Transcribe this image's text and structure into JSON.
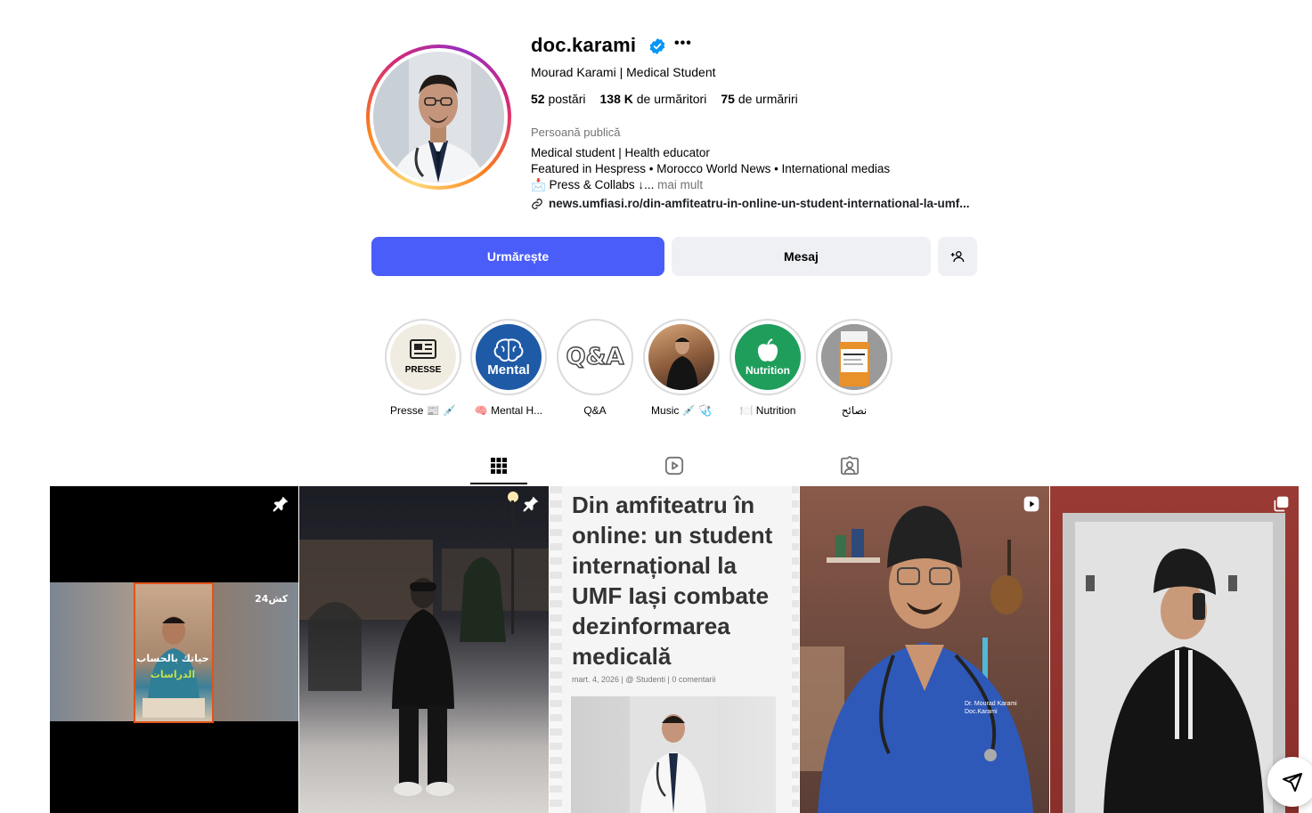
{
  "profile": {
    "username": "doc.karami",
    "more_icon": "•••",
    "full_name": "Mourad Karami | Medical Student",
    "stats": {
      "posts_count": "52",
      "posts_label": "postări",
      "followers_count": "138 K",
      "followers_label": "de urmăritori",
      "following_count": "75",
      "following_label": "de urmăriri"
    },
    "category": "Persoană publică",
    "bio_line1": "Medical student | Health educator",
    "bio_line2": "Featured in Hespress • Morocco World News • International medias",
    "bio_line3": "📩 Press & Collabs ↓...",
    "more_link": "mai mult",
    "link_text": "news.umfiasi.ro/din-amfiteatru-in-online-un-student-international-la-umf..."
  },
  "actions": {
    "follow_label": "Urmărește",
    "message_label": "Mesaj"
  },
  "highlights": [
    {
      "label": "Presse 📰 💉",
      "cover_text": "PRESSE"
    },
    {
      "label": "🧠 Mental H...",
      "cover_text": "Mental"
    },
    {
      "label": "Q&A",
      "cover_text": "Q&A"
    },
    {
      "label": "Music 💉 🩺",
      "cover_text": ""
    },
    {
      "label": "🍽️ Nutrition",
      "cover_text": "Nutrition"
    },
    {
      "label": "نصائح",
      "cover_text": ""
    }
  ],
  "posts": {
    "p1_overlay_top": "حياتك بالحساب",
    "p1_overlay_bottom": "الدراسات",
    "p1_logo": "كش24",
    "p3_title": "Din amfiteatru în online: un student internațional la UMF Iași combate dezinformarea medicală",
    "p3_meta": "mart. 4, 2026 | @ Studenti | 0 comentarii",
    "p4_scrub_text": "Dr. Mourad Karami Doc.Karami"
  },
  "colors": {
    "follow_button": "#4a5df9",
    "secondary_button": "#eff0f4",
    "verified": "#0095f6",
    "mental_highlight": "#1f5aa6",
    "nutrition_highlight": "#1f9e5b"
  },
  "icons": [
    "verified-badge-icon",
    "more-options-icon",
    "link-icon",
    "add-person-icon",
    "posts-grid-icon",
    "reels-icon",
    "tagged-icon",
    "pin-icon",
    "reel-badge-icon",
    "carousel-icon",
    "share-icon"
  ]
}
